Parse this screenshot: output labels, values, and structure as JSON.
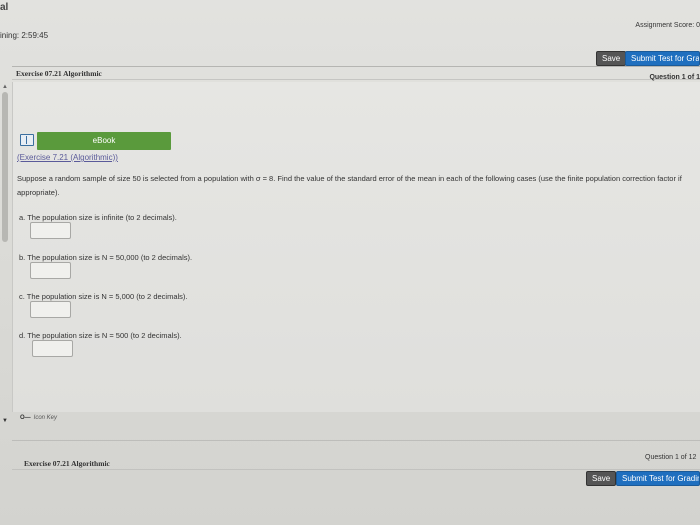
{
  "header": {
    "app_title": "al",
    "timer": "ining: 2:59:45",
    "score": "Assignment Score: 0"
  },
  "toolbar": {
    "save_label": "Save",
    "submit_label": "Submit Test for Grad"
  },
  "exercise": {
    "title": "Exercise 07.21 Algorithmic",
    "question_of": "Question 1 of 1"
  },
  "ebook": {
    "label": "eBook"
  },
  "problem": {
    "link": "(Exercise 7.21 (Algorithmic))",
    "text": "Suppose a random sample of size 50 is selected from a population with σ = 8. Find the value of the standard error of the mean in each of the following cases (use the finite population correction factor if appropriate).",
    "parts": [
      {
        "label": "a. The population size is infinite (to 2 decimals).",
        "value": ""
      },
      {
        "label": "b. The population size is N = 50,000 (to 2 decimals).",
        "value": ""
      },
      {
        "label": "c. The population size is N = 5,000 (to 2 decimals).",
        "value": ""
      },
      {
        "label": "d. The population size is N = 500 (to 2 decimals).",
        "value": ""
      }
    ]
  },
  "footer": {
    "icon_key_glyph": "O—",
    "icon_key": "Icon Key",
    "exercise_title": "Exercise 07.21 Algorithmic",
    "question_of": "Question 1 of 12",
    "save_label": "Save",
    "submit_label": "Submit Test for Grading"
  },
  "colors": {
    "submit_blue": "#1f6fbf",
    "ebook_green": "#5a9a3c",
    "save_gray": "#555555"
  }
}
